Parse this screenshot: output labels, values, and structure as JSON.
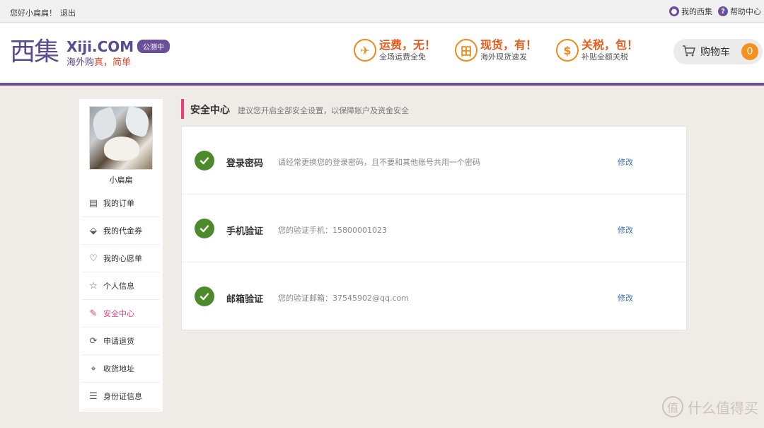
{
  "topbar": {
    "greeting": "您好小扁扁！",
    "logout": "退出",
    "my_xiji": "我的西集",
    "help": "帮助中心"
  },
  "header": {
    "logo_mark": "西集",
    "logo_text": "Xiji.COM",
    "slogan_a": "海外购",
    "slogan_b": "真",
    "slogan_c": "，简单",
    "beta": "公测中",
    "promos": [
      {
        "title": "运费，无！",
        "sub": "全场运费全免",
        "icon": "plane-icon"
      },
      {
        "title": "现货，有！",
        "sub": "海外现货速发",
        "icon": "gift-icon"
      },
      {
        "title": "关税，包！",
        "sub": "补贴全额关税",
        "icon": "money-icon"
      }
    ],
    "cart_label": "购物车",
    "cart_count": "0"
  },
  "sidebar": {
    "username": "小扁扁",
    "items": [
      {
        "label": "我的订单",
        "icon": "order-icon"
      },
      {
        "label": "我的代金券",
        "icon": "coupon-icon"
      },
      {
        "label": "我的心愿单",
        "icon": "heart-icon"
      },
      {
        "label": "个人信息",
        "icon": "star-icon"
      },
      {
        "label": "安全中心",
        "icon": "edit-icon",
        "active": true
      },
      {
        "label": "申请退货",
        "icon": "return-icon"
      },
      {
        "label": "收货地址",
        "icon": "location-icon"
      },
      {
        "label": "身份证信息",
        "icon": "id-card-icon"
      }
    ]
  },
  "main": {
    "title": "安全中心",
    "tip": "建议您开启全部安全设置，以保障账户及资金安全",
    "rows": [
      {
        "title": "登录密码",
        "desc": "请经常更换您的登录密码，且不要和其他账号共用一个密码",
        "action": "修改"
      },
      {
        "title": "手机验证",
        "desc": "您的验证手机：15800001023",
        "action": "修改"
      },
      {
        "title": "邮箱验证",
        "desc": "您的验证邮箱：37545902@qq.com",
        "action": "修改"
      }
    ]
  },
  "watermark": "什么值得买",
  "colors": {
    "brand_purple": "#6b4f9a",
    "accent_pink": "#e8407a",
    "promo_orange": "#f08a1b",
    "check_green": "#4b8b2a",
    "link_blue": "#3a6fb0"
  }
}
